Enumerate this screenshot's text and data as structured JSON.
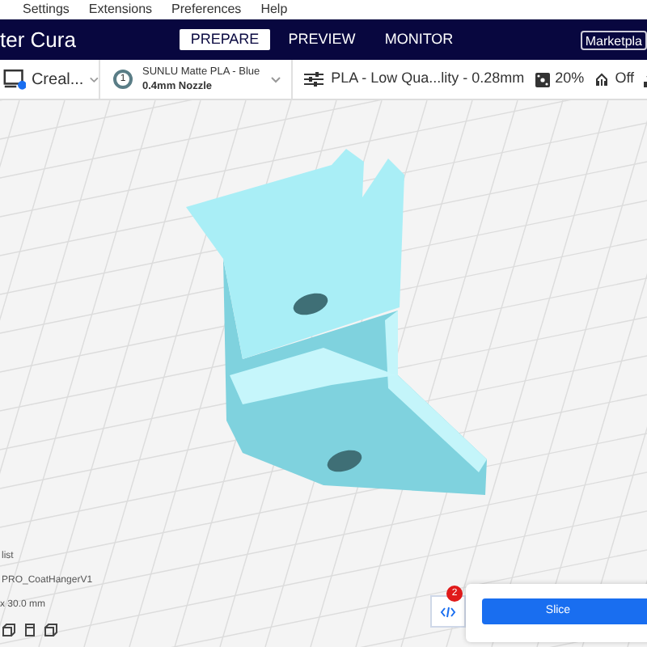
{
  "menu": [
    {
      "label": "Settings"
    },
    {
      "label": "Extensions"
    },
    {
      "label": "Preferences"
    },
    {
      "label": "Help"
    }
  ],
  "header": {
    "title": "ter Cura",
    "tabs": [
      {
        "label": "PREPARE",
        "selected": true
      },
      {
        "label": "PREVIEW",
        "selected": false
      },
      {
        "label": "MONITOR",
        "selected": false
      }
    ],
    "marketplace": "Marketpla"
  },
  "toolbar": {
    "printer": "Creal...",
    "material": {
      "name": "SUNLU Matte PLA - Blue",
      "nozzle": "0.4mm Nozzle",
      "extruder": "1"
    },
    "profile": "PLA - Low Qua...lity - 0.28mm",
    "infill": "20%",
    "support": "Off"
  },
  "object_info": {
    "heading": "list",
    "name": "PRO_CoatHangerV1",
    "size": "x 30.0 mm"
  },
  "slice": {
    "badge": "2",
    "button": "Slice"
  }
}
